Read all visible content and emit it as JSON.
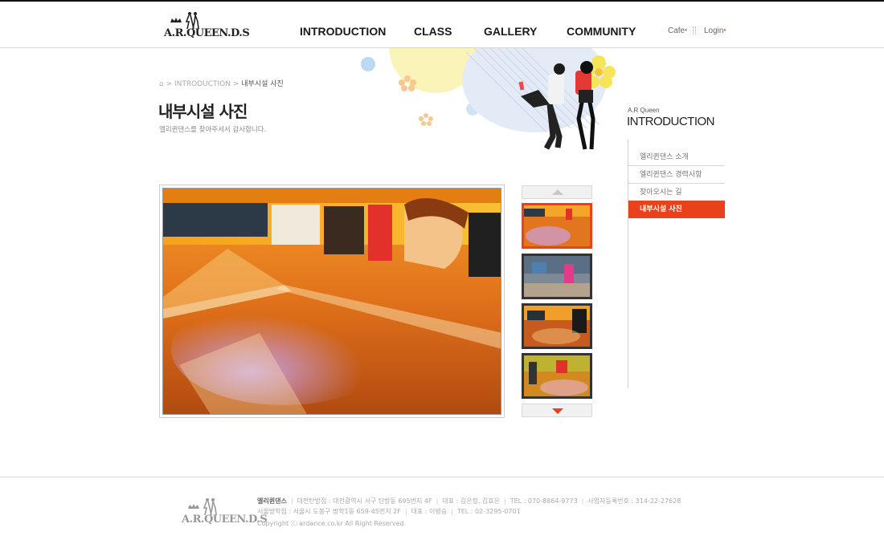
{
  "header": {
    "logo_text": "A.R.QUEEN.D.S",
    "nav": [
      "INTRODUCTION",
      "CLASS",
      "GALLERY",
      "COMMUNITY"
    ],
    "util": {
      "cafe": "Cafe",
      "login": "Login"
    }
  },
  "breadcrumb": {
    "home_icon": "home-icon",
    "section": "INTRODUCTION",
    "current": "내부시설 사진"
  },
  "page": {
    "title": "내부시설 사진",
    "subtitle": "엘리퀸댄스를 찾아주셔서 감사합니다."
  },
  "sidebar": {
    "label_small": "A.R Queen",
    "label_big": "INTRODUCTION",
    "items": [
      {
        "label": "엘리퀸댄스 소개",
        "active": false
      },
      {
        "label": "엘리퀸댄스 경력사항",
        "active": false
      },
      {
        "label": "찾아오시는 길",
        "active": false
      },
      {
        "label": "내부시설 사진",
        "active": true
      }
    ]
  },
  "gallery": {
    "up_icon": "arrow-up-icon",
    "down_icon": "arrow-down-icon",
    "thumb_count": 4,
    "active_index": 0
  },
  "footer": {
    "logo_text": "A.R.QUEEN.D.S",
    "company": "엘리퀸댄스",
    "line1": [
      "대전탄방점 : 대전광역시 서구 탄방동 695번지 4F",
      "대표 : 김은정, 김효은",
      "TEL : 070-8864-9773",
      "사업자등록번호 : 314-22-27628"
    ],
    "line2": [
      "서울방학점 : 서울시 도봉구 방학1동 659-45번지 2F",
      "대표 : 이병승",
      "TEL : 02-3295-0701"
    ],
    "copyright": "Copyright ⓒ ardance.co.kr  All Right Reserved."
  },
  "colors": {
    "accent": "#e8411b",
    "text": "#222222",
    "muted": "#888888"
  }
}
